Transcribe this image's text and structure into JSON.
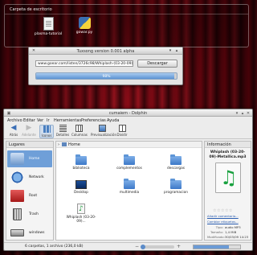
{
  "desktop": {
    "widget_title": "Carpeta de escritorio",
    "icons": [
      {
        "label": "plasma-tutorial",
        "icon": "text-file-icon"
      },
      {
        "label": "gowar.py",
        "icon": "python-file-icon"
      }
    ]
  },
  "downloader": {
    "title": "Tuxsong version 0.001 alpha",
    "url": "www.goear.com/listen/3726c98/Whiplash-(03-20-09)-Metallica",
    "download_label": "Descargar",
    "progress_percent": 98,
    "progress_text": "98%"
  },
  "dolphin": {
    "title": "cumaiem - Dolphin",
    "menu": [
      "Archivo",
      "Editar",
      "Ver",
      "Ir",
      "Herramientas",
      "Preferencias",
      "Ayuda"
    ],
    "toolbar": [
      {
        "label": "Atrás",
        "icon": "back-icon",
        "enabled": true
      },
      {
        "label": "Adelante",
        "icon": "forward-icon",
        "enabled": false
      },
      {
        "label": "Iconos",
        "icon": "icons-view-icon",
        "enabled": true,
        "active": true
      },
      {
        "label": "Detalles",
        "icon": "details-view-icon",
        "enabled": true
      },
      {
        "label": "Columnas",
        "icon": "columns-view-icon",
        "enabled": true
      },
      {
        "label": "Previsualización",
        "icon": "preview-icon",
        "enabled": true
      },
      {
        "label": "Dividir",
        "icon": "split-icon",
        "enabled": true
      }
    ],
    "places": {
      "title": "Lugares",
      "items": [
        {
          "label": "Home",
          "icon": "home-icon",
          "selected": true
        },
        {
          "label": "Network",
          "icon": "network-icon",
          "selected": false
        },
        {
          "label": "Root",
          "icon": "root-folder-icon",
          "selected": false
        },
        {
          "label": "Trash",
          "icon": "trash-icon",
          "selected": false
        },
        {
          "label": "windows",
          "icon": "drive-icon",
          "selected": false
        }
      ]
    },
    "breadcrumb": {
      "label": "Home"
    },
    "files": [
      {
        "label": "biblioteca",
        "icon": "folder-icon"
      },
      {
        "label": "complementos",
        "icon": "folder-icon"
      },
      {
        "label": "descargas",
        "icon": "folder-icon"
      },
      {
        "label": "Desktop",
        "icon": "desktop-folder-icon"
      },
      {
        "label": "multimedia",
        "icon": "folder-icon"
      },
      {
        "label": "programacion",
        "icon": "folder-icon"
      },
      {
        "label": "Whiplash (03-20-09)...",
        "icon": "mp3-file-icon"
      }
    ],
    "info": {
      "title": "Información",
      "filename": "Whiplash (03-20-09)-Metallica.mp3",
      "rating": "☆☆☆☆☆",
      "add_comment": "Añadir comentario...",
      "change_tags": "Cambiar etiquetas...",
      "type_label": "Tipo:",
      "type_value": "audio MP3",
      "size_label": "Tamaño:",
      "size_value": "1,4 MiB",
      "modified_label": "Modificado:",
      "modified_value": "30/03/09 14:23"
    },
    "status": {
      "text": "6 carpetas, 1 archivo (236,0 kB)"
    }
  },
  "colors": {
    "accent": "#6f9fd8",
    "progress": "#5b93d3",
    "wallpaper": "#7a0a14"
  }
}
